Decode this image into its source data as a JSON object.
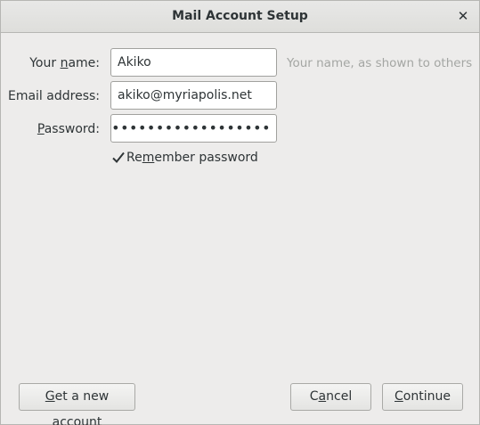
{
  "window": {
    "title": "Mail Account Setup",
    "close_glyph": "✕"
  },
  "form": {
    "name_label_pre": "Your ",
    "name_label_mn": "n",
    "name_label_post": "ame:",
    "name_value": "Akiko",
    "name_hint": "Your name, as shown to others",
    "email_label": "Email address:",
    "email_value": "akiko@myriapolis.net",
    "password_label_mn": "P",
    "password_label_post": "assword:",
    "password_mask": "•••••••••••••••••••",
    "remember_checked": true,
    "remember_pre": "Re",
    "remember_mn": "m",
    "remember_post": "ember password"
  },
  "buttons": {
    "new_account_mn": "G",
    "new_account_post": "et a new account",
    "cancel_pre": "C",
    "cancel_mn": "a",
    "cancel_post": "ncel",
    "continue_mn": "C",
    "continue_post": "ontinue"
  },
  "icons": {
    "close": "close-icon",
    "checkbox": "checkmark-icon"
  }
}
